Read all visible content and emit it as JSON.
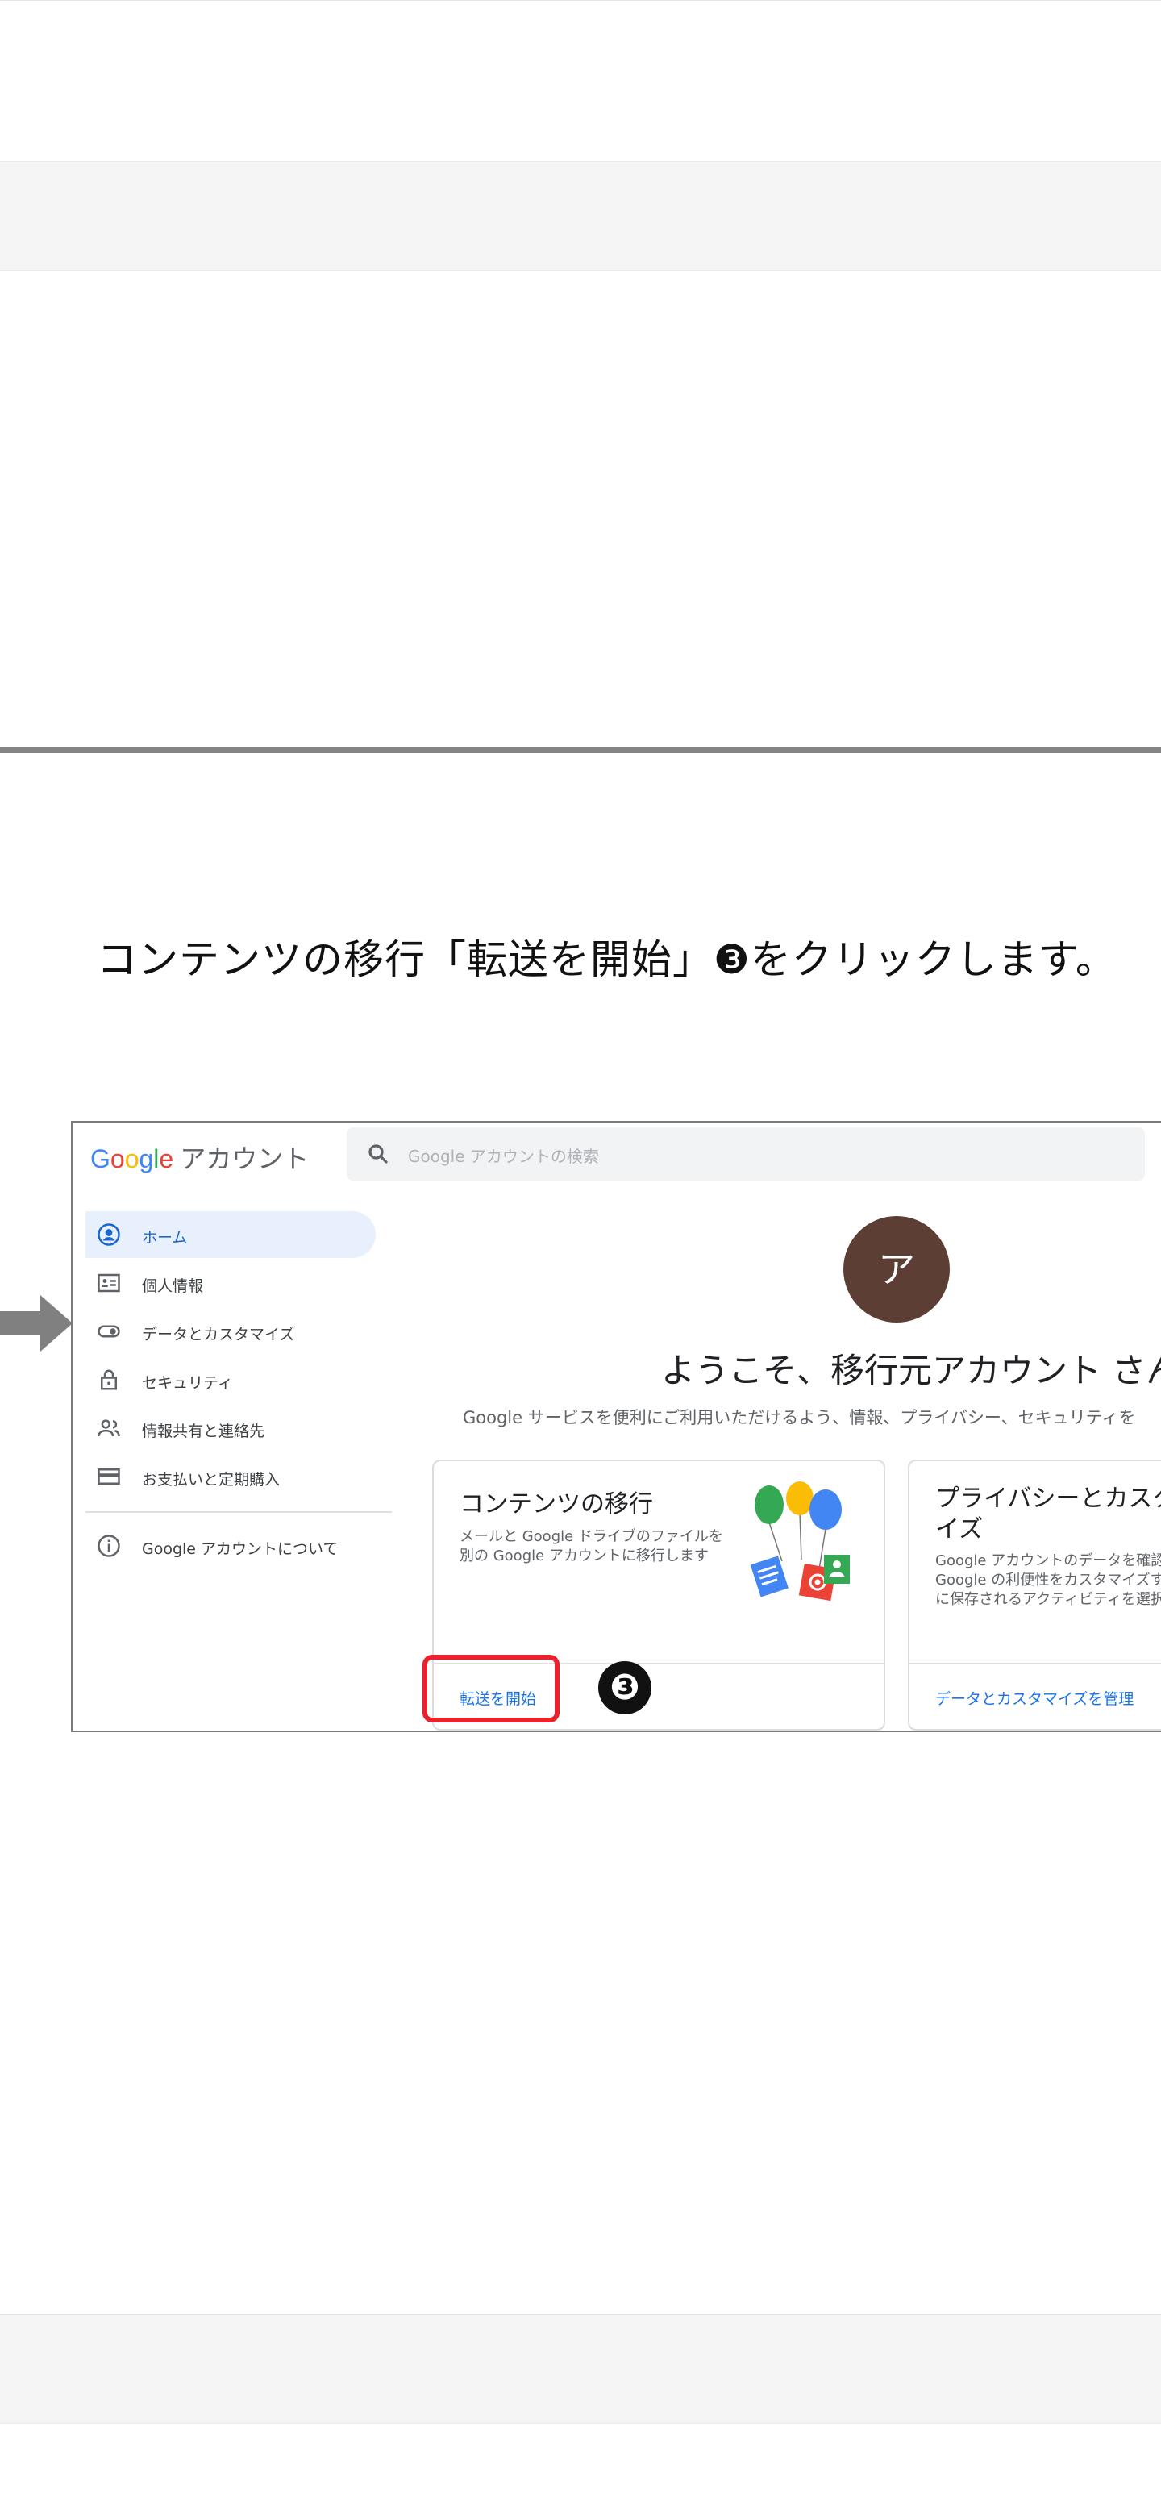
{
  "instruction": "コンテンツの移行「転送を開始」❸をクリックします。",
  "screenshot": {
    "logo": {
      "google_letters": [
        "G",
        "o",
        "o",
        "g",
        "l",
        "e"
      ],
      "product": "アカウント"
    },
    "search": {
      "placeholder": "Google アカウントの検索"
    },
    "sidebar": {
      "items": [
        {
          "label": "ホーム",
          "icon": "account-circle-icon",
          "active": true
        },
        {
          "label": "個人情報",
          "icon": "id-card-icon",
          "active": false
        },
        {
          "label": "データとカスタマイズ",
          "icon": "toggle-icon",
          "active": false
        },
        {
          "label": "セキュリティ",
          "icon": "lock-icon",
          "active": false
        },
        {
          "label": "情報共有と連絡先",
          "icon": "people-icon",
          "active": false
        },
        {
          "label": "お支払いと定期購入",
          "icon": "credit-card-icon",
          "active": false
        }
      ],
      "about": {
        "label": "Google アカウントについて",
        "icon": "info-icon"
      }
    },
    "avatar_initial": "ア",
    "welcome": "ようこそ、移行元アカウント さん",
    "subtitle": "Google サービスを便利にご利用いただけるよう、情報、プライバシー、セキュリティを",
    "cards": [
      {
        "title": "コンテンツの移行",
        "description": "メールと Google ドライブのファイルを別の Google アカウントに移行します",
        "link": "転送を開始"
      },
      {
        "title": "プライバシーとカスタマイズ",
        "description": "Google アカウントのデータを確認し、Google の利便性をカスタマイズするために保存されるアクティビティを選択します",
        "link": "データとカスタマイズを管理"
      }
    ],
    "step_badge": "❸",
    "colors": {
      "highlight": "#e8232d",
      "link": "#1a73e8",
      "active_bg": "#e8f0fe",
      "avatar": "#5d3e34"
    }
  }
}
